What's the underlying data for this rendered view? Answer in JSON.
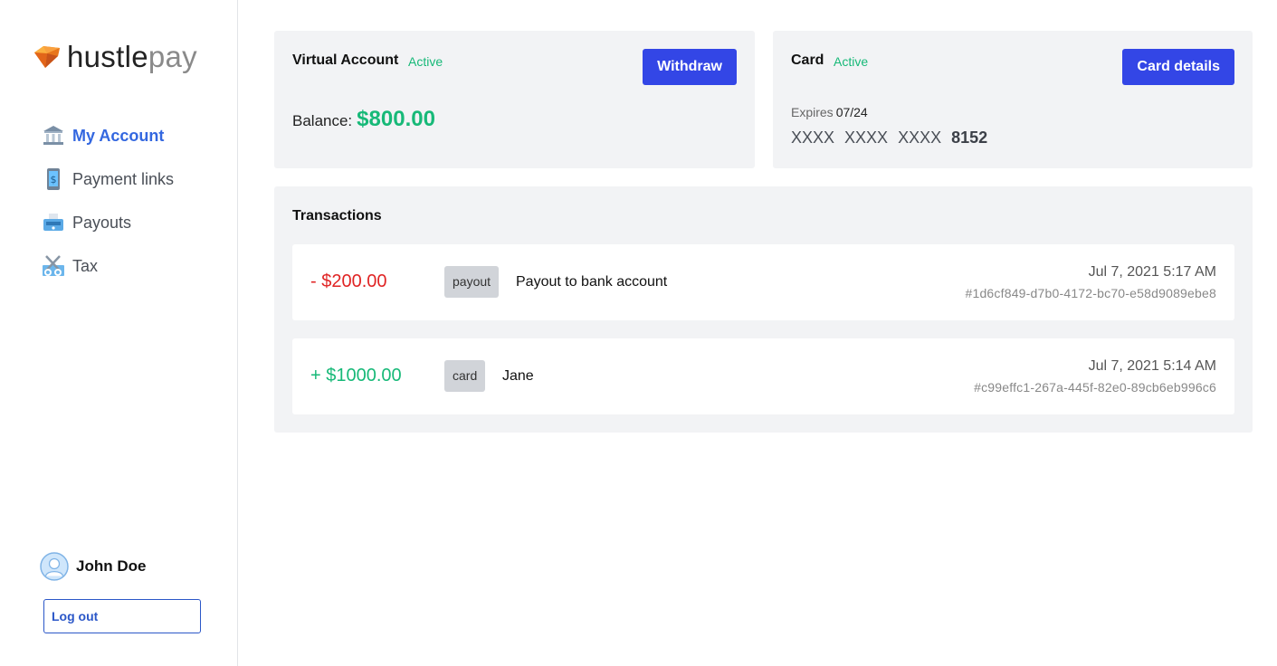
{
  "brand": {
    "part1": "hustle",
    "part2": "pay",
    "gem_color": "#f58a1f"
  },
  "nav": {
    "items": [
      {
        "label": "My Account",
        "icon": "bank-icon",
        "active": true
      },
      {
        "label": "Payment links",
        "icon": "phone-dollar-icon",
        "active": false
      },
      {
        "label": "Payouts",
        "icon": "cash-register-icon",
        "active": false
      },
      {
        "label": "Tax",
        "icon": "scissors-icon",
        "active": false
      }
    ]
  },
  "user": {
    "name": "John Doe",
    "logout_label": "Log out"
  },
  "account": {
    "title": "Virtual Account",
    "status": "Active",
    "withdraw_label": "Withdraw",
    "balance_label": "Balance:",
    "balance_value": "$800.00"
  },
  "card": {
    "title": "Card",
    "status": "Active",
    "details_label": "Card details",
    "expires_label": "Expires",
    "expires_value": "07/24",
    "number_groups": [
      "XXXX",
      "XXXX",
      "XXXX"
    ],
    "last4": "8152"
  },
  "transactions": {
    "title": "Transactions",
    "rows": [
      {
        "amount": "- $200.00",
        "tag": "payout",
        "description": "Payout to bank account",
        "date": "Jul 7, 2021 5:17 AM",
        "hash": "#1d6cf849-d7b0-4172-bc70-e58d9089ebe8"
      },
      {
        "amount": "+ $1000.00",
        "tag": "card",
        "description": "Jane",
        "date": "Jul 7, 2021 5:14 AM",
        "hash": "#c99effc1-267a-445f-82e0-89cb6eb996c6"
      }
    ]
  },
  "colors": {
    "accent": "#3346e6",
    "positive": "#17b978",
    "negative": "#e02424",
    "nav_active": "#3367e0"
  }
}
